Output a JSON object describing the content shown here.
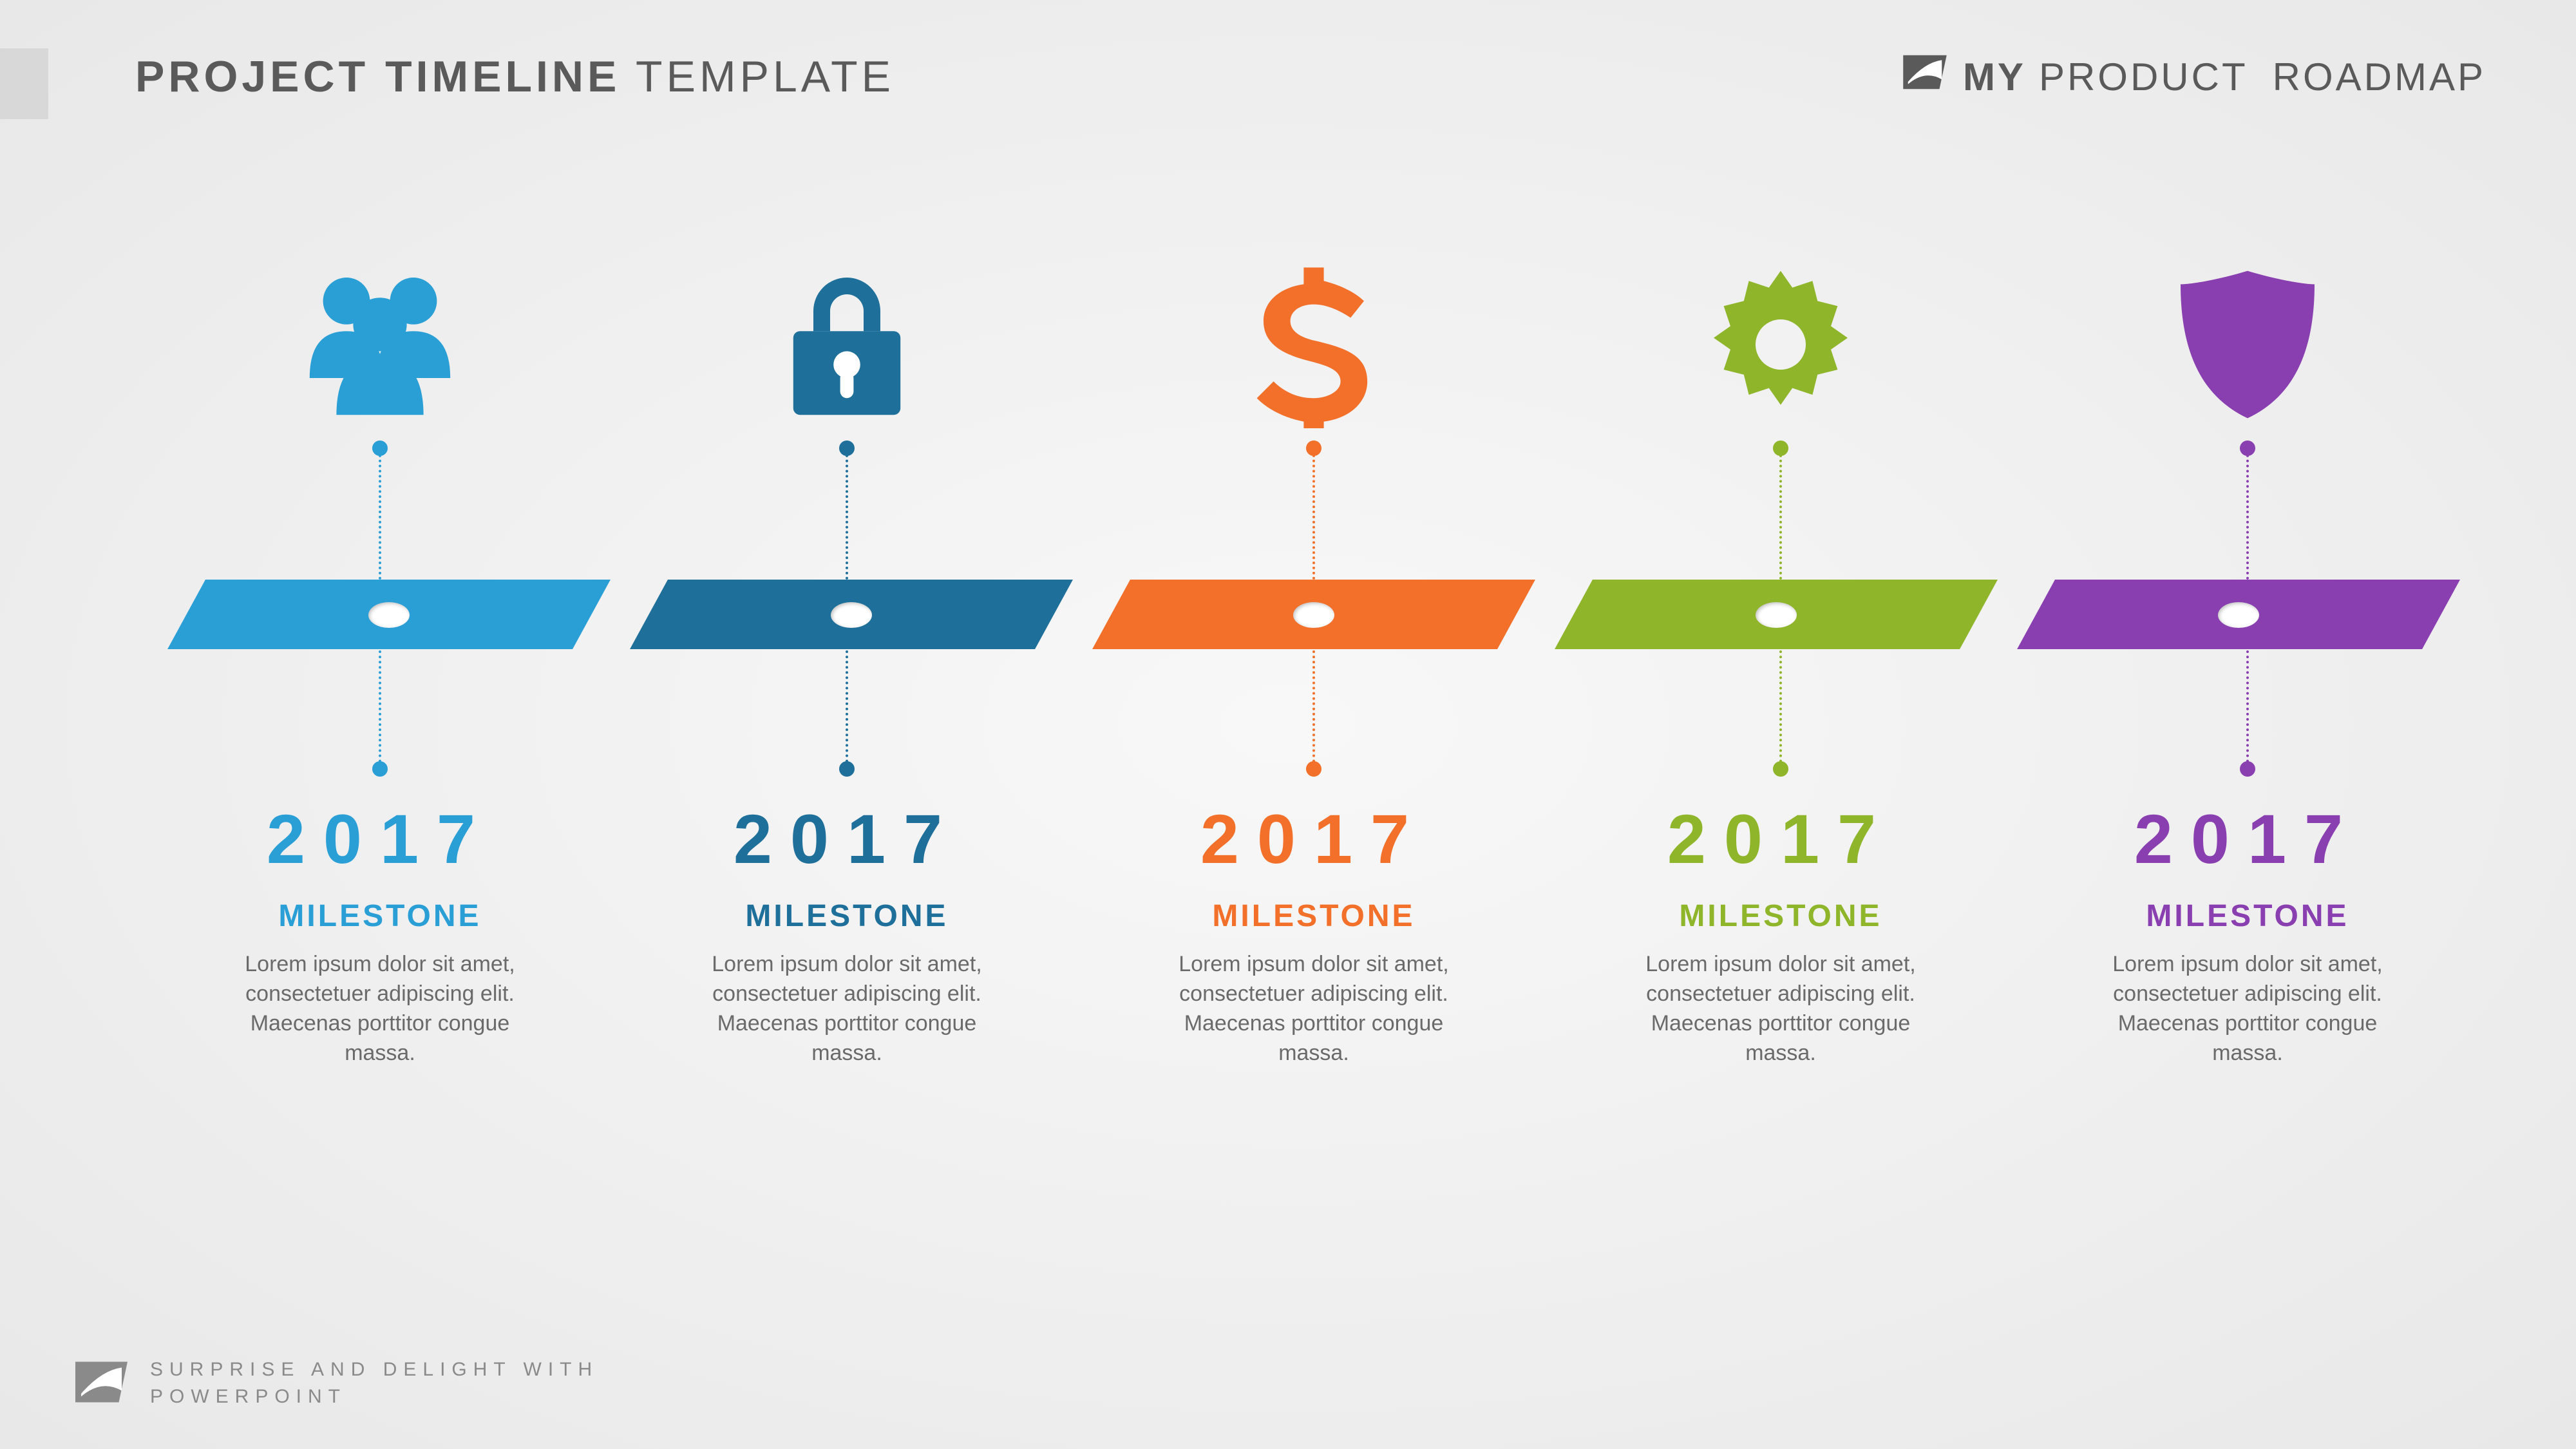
{
  "header": {
    "title_bold": "PROJECT TIMELINE",
    "title_light": " TEMPLATE",
    "brand_bold": "MY",
    "brand_mid": " PRODUCT",
    "brand_light": "ROADMAP"
  },
  "milestones": [
    {
      "year": "2017",
      "subtitle": "MILESTONE",
      "body": "Lorem ipsum dolor sit amet, consectetuer adipiscing elit. Maecenas porttitor congue massa.",
      "color": "#2a9fd6",
      "icon": "people-icon"
    },
    {
      "year": "2017",
      "subtitle": "MILESTONE",
      "body": "Lorem ipsum dolor sit amet, consectetuer adipiscing elit. Maecenas porttitor congue massa.",
      "color": "#1e6f9a",
      "icon": "lock-icon"
    },
    {
      "year": "2017",
      "subtitle": "MILESTONE",
      "body": "Lorem ipsum dolor sit amet, consectetuer adipiscing elit. Maecenas porttitor congue massa.",
      "color": "#f2702a",
      "icon": "dollar-icon"
    },
    {
      "year": "2017",
      "subtitle": "MILESTONE",
      "body": "Lorem ipsum dolor sit amet, consectetuer adipiscing elit. Maecenas porttitor congue massa.",
      "color": "#8fb52a",
      "icon": "gear-icon"
    },
    {
      "year": "2017",
      "subtitle": "MILESTONE",
      "body": "Lorem ipsum dolor sit amet, consectetuer adipiscing elit. Maecenas porttitor congue massa.",
      "color": "#8a3fb0",
      "icon": "shield-icon"
    }
  ],
  "footer": {
    "line1": "SURPRISE AND DELIGHT WITH",
    "line2": "POWERPOINT"
  }
}
